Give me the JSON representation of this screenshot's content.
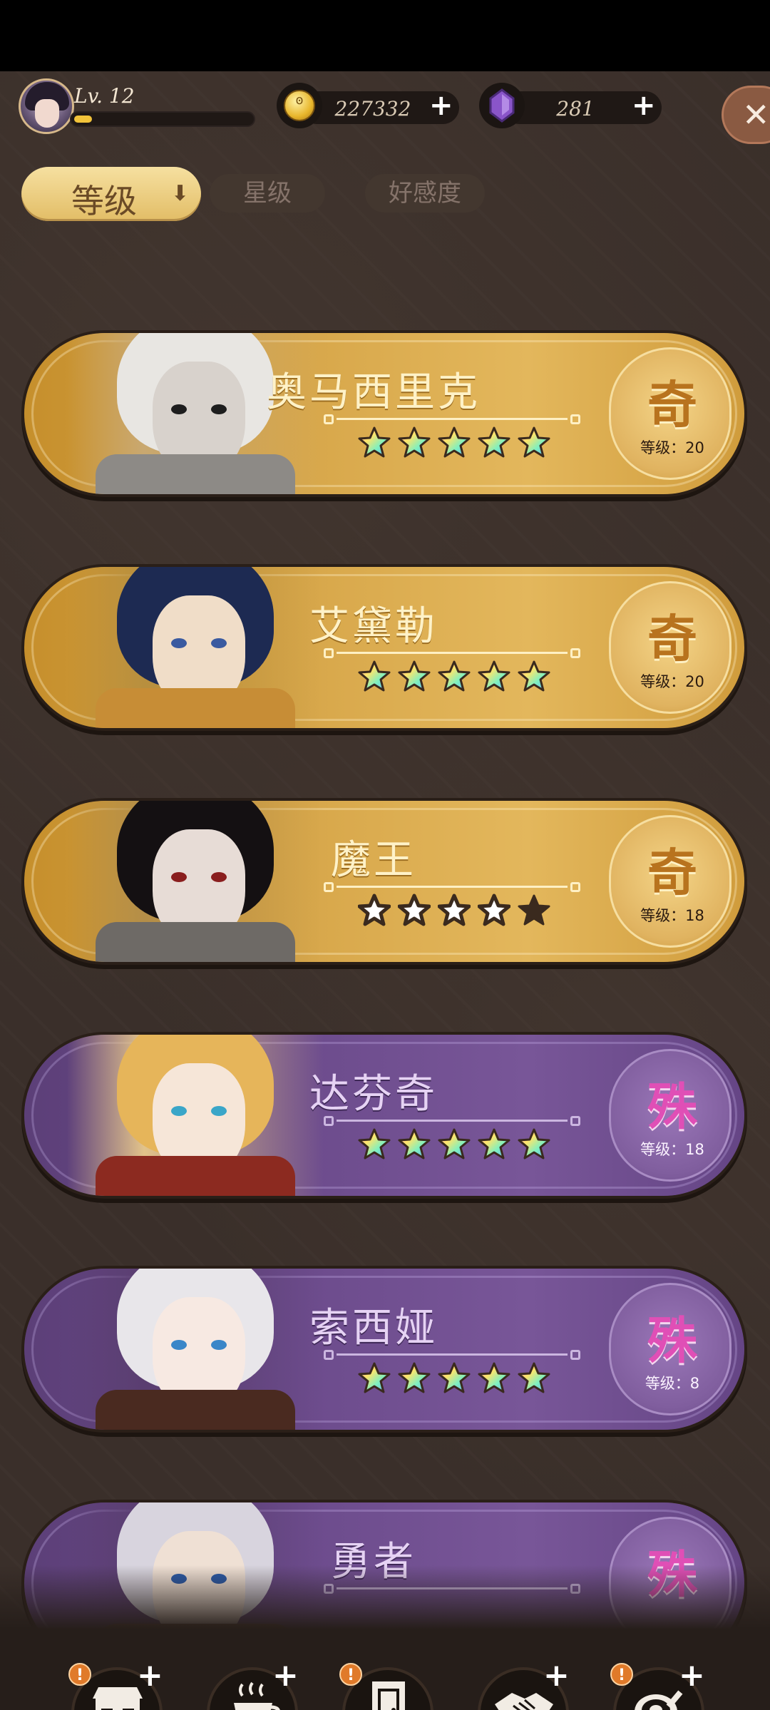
{
  "player": {
    "level": "Lv. 12",
    "xp_progress": 0.1
  },
  "currencies": {
    "coins": {
      "amount": "227332",
      "icon": "coin-icon"
    },
    "gems": {
      "amount": "281",
      "icon": "purple-gem-icon"
    }
  },
  "sort_tabs": [
    {
      "label": "等级",
      "active": true
    },
    {
      "label": "星级",
      "active": false
    },
    {
      "label": "好感度",
      "active": false
    }
  ],
  "heroes": [
    {
      "name": "奥马西里克",
      "rank_glyph": "奇",
      "level_text": "等级：20",
      "tier": "gold",
      "stars_filled": 5
    },
    {
      "name": "艾黛勒",
      "rank_glyph": "奇",
      "level_text": "等级：20",
      "tier": "gold",
      "stars_filled": 5
    },
    {
      "name": "魔王",
      "rank_glyph": "奇",
      "level_text": "等级：18",
      "tier": "gold",
      "stars_filled": 4,
      "dark_stars": 1
    },
    {
      "name": "达芬奇",
      "rank_glyph": "殊",
      "level_text": "等级：18",
      "tier": "purple",
      "stars_filled": 5
    },
    {
      "name": "索西娅",
      "rank_glyph": "殊",
      "level_text": "等级：8",
      "tier": "purple",
      "stars_filled": 5
    },
    {
      "name": "勇者",
      "rank_glyph": "殊",
      "level_text": "",
      "tier": "purple",
      "stars_filled": 0
    }
  ],
  "nav": [
    {
      "label": "店铺",
      "icon": "shop-icon",
      "alert": true,
      "plus": true
    },
    {
      "label": "社交",
      "icon": "coffee-cup-icon",
      "alert": false,
      "plus": true
    },
    {
      "label": "招募",
      "icon": "door-icon",
      "alert": true,
      "plus": false
    },
    {
      "label": "相遇",
      "icon": "handshake-icon",
      "alert": false,
      "plus": true
    },
    {
      "label": "厨房",
      "icon": "frying-pan-icon",
      "alert": true,
      "plus": true
    }
  ],
  "glyphs": {
    "plus": "+",
    "close": "✕",
    "sort_arrow": "⬇",
    "alert": "!"
  },
  "colors": {
    "gold_card": "#d6a548",
    "purple_card": "#6d4c8d",
    "background": "#3a2f2a",
    "xp_fill": "#f2c33a"
  }
}
